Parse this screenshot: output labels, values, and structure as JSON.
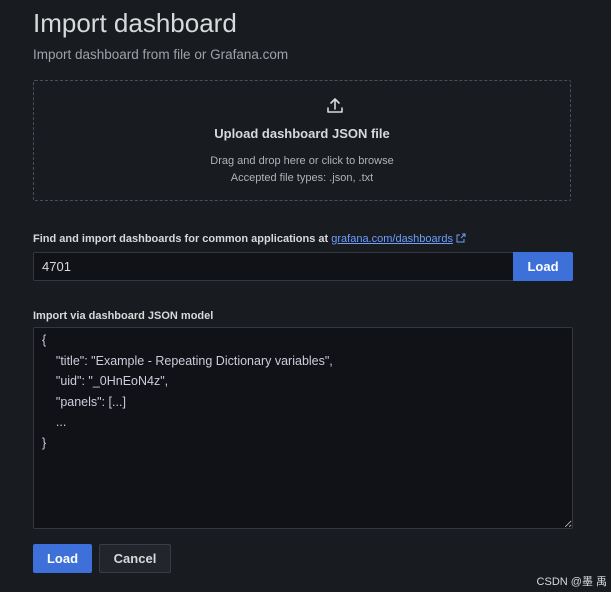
{
  "page": {
    "title": "Import dashboard",
    "subtitle": "Import dashboard from file or Grafana.com"
  },
  "upload": {
    "icon": "upload-icon",
    "title": "Upload dashboard JSON file",
    "hint_drag": "Drag and drop here or click to browse",
    "hint_types": "Accepted file types: .json, .txt"
  },
  "grafana_com": {
    "label": "Find and import dashboards for common applications at ",
    "link_text": "grafana.com/dashboards",
    "link_icon": "external-link-icon",
    "input_value": "4701",
    "load_label": "Load"
  },
  "json_model": {
    "label": "Import via dashboard JSON model",
    "value": "{\n    \"title\": \"Example - Repeating Dictionary variables\",\n    \"uid\": \"_0HnEoN4z\",\n    \"panels\": [...]\n    ...\n}"
  },
  "actions": {
    "load_label": "Load",
    "cancel_label": "Cancel"
  },
  "colors": {
    "background": "#181b1f",
    "primary": "#3d71d9",
    "link": "#6e9fff"
  },
  "watermark": "CSDN @墨 禹"
}
